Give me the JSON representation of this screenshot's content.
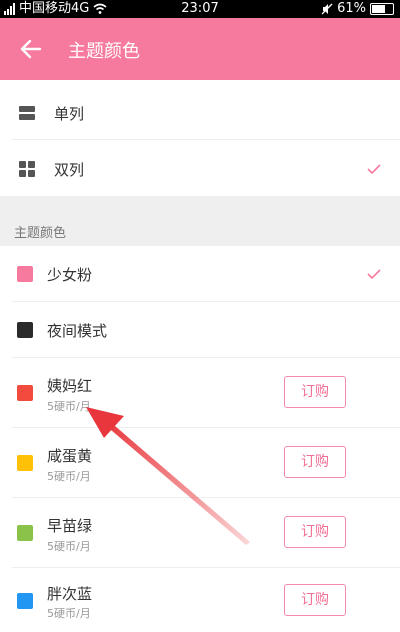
{
  "status_bar": {
    "carrier": "中国移动4G",
    "time": "23:07",
    "battery": "61%"
  },
  "app_bar": {
    "title": "主题颜色",
    "back_icon": "arrow-left-icon"
  },
  "layout_options": [
    {
      "label": "单列",
      "icon": "single-column-icon",
      "selected": false
    },
    {
      "label": "双列",
      "icon": "grid-icon",
      "selected": true
    }
  ],
  "theme_section": {
    "header": "主题颜色",
    "items": [
      {
        "name": "少女粉",
        "color": "#f67a9d",
        "selected": true
      },
      {
        "name": "夜间模式",
        "color": "#2b2b2b",
        "selected": false
      },
      {
        "name": "姨妈红",
        "color": "#f24b3e",
        "price": "5硬币/月",
        "button": "订购"
      },
      {
        "name": "咸蛋黄",
        "color": "#ffc107",
        "price": "5硬币/月",
        "button": "订购"
      },
      {
        "name": "早苗绿",
        "color": "#8bc34a",
        "price": "5硬币/月",
        "button": "订购"
      },
      {
        "name": "胖次蓝",
        "color": "#2196f3",
        "price": "5硬币/月",
        "button": "订购"
      }
    ]
  },
  "colors": {
    "accent": "#f67a9d",
    "annotation_arrow": "#e8363c"
  }
}
